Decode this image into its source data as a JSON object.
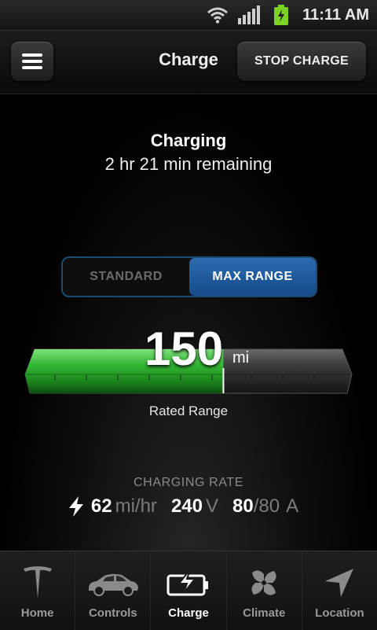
{
  "status_bar": {
    "time": "11:11 AM"
  },
  "header": {
    "title": "Charge",
    "stop_label": "STOP CHARGE"
  },
  "status": {
    "title": "Charging",
    "remaining": "2 hr 21 min remaining"
  },
  "mode_toggle": {
    "options": [
      "STANDARD",
      "MAX RANGE"
    ],
    "selected": "MAX RANGE"
  },
  "range": {
    "value": "150",
    "unit": "mi",
    "label": "Rated Range",
    "fill_fraction": 0.61
  },
  "charging_rate": {
    "title": "CHARGING RATE",
    "speed": "62",
    "speed_unit": "mi/hr",
    "voltage": "240",
    "voltage_unit": "V",
    "current": "80",
    "current_max": "/80",
    "current_unit": "A"
  },
  "nav": {
    "items": [
      {
        "label": "Home",
        "icon": "tesla-logo-icon"
      },
      {
        "label": "Controls",
        "icon": "car-icon"
      },
      {
        "label": "Charge",
        "icon": "battery-charge-icon"
      },
      {
        "label": "Climate",
        "icon": "fan-icon"
      },
      {
        "label": "Location",
        "icon": "location-arrow-icon"
      }
    ],
    "active": "Charge"
  },
  "colors": {
    "accent_blue": "#1f5ea3",
    "charge_green": "#2fb52f",
    "background": "#000000"
  }
}
